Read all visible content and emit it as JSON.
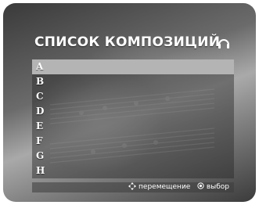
{
  "header": {
    "title": "СПИСОК КОМПОЗИЦИЙ",
    "icon": "headphones-icon"
  },
  "playlist": {
    "selected_index": 0,
    "items": [
      {
        "label": "A"
      },
      {
        "label": "B"
      },
      {
        "label": "C"
      },
      {
        "label": "D"
      },
      {
        "label": "E"
      },
      {
        "label": "F"
      },
      {
        "label": "G"
      },
      {
        "label": "H"
      }
    ]
  },
  "footer": {
    "navigate_icon": "dpad-arrows-icon",
    "navigate_label": "перемещение",
    "select_icon": "ok-button-icon",
    "select_label": "выбор"
  },
  "colors": {
    "selection": "#b4b4b4",
    "text": "#ffffff"
  }
}
